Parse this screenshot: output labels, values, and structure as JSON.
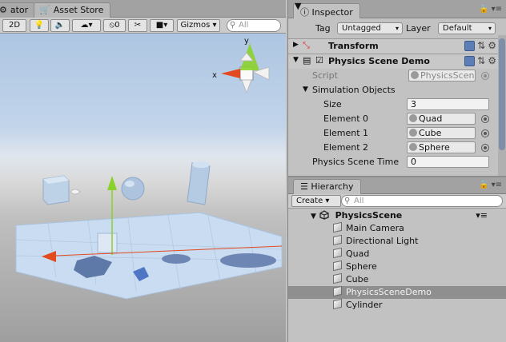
{
  "scene": {
    "tabs": [
      {
        "label": "ator",
        "icon": "gear-icon"
      },
      {
        "label": "Asset Store",
        "icon": "cart-icon"
      }
    ],
    "toolbar": {
      "mode_2d": "2D",
      "fx_count": "0",
      "gizmos_label": "Gizmos",
      "search_placeholder": "All"
    },
    "axis_label_x": "x",
    "axis_label_y": "y"
  },
  "inspector": {
    "tab_label": "Inspector",
    "tag_label": "Tag",
    "tag_value": "Untagged",
    "layer_label": "Layer",
    "layer_value": "Default",
    "transform_title": "Transform",
    "component_title": "Physics Scene Demo",
    "component_enabled": true,
    "script_label": "Script",
    "script_value": "PhysicsScen",
    "sim_objects_label": "Simulation Objects",
    "size_label": "Size",
    "size_value": "3",
    "elements": [
      {
        "label": "Element 0",
        "value": "Quad"
      },
      {
        "label": "Element 1",
        "value": "Cube"
      },
      {
        "label": "Element 2",
        "value": "Sphere"
      }
    ],
    "pst_label": "Physics Scene Time",
    "pst_value": "0"
  },
  "hierarchy": {
    "tab_label": "Hierarchy",
    "create_label": "Create",
    "search_placeholder": "All",
    "scene_name": "PhysicsScene",
    "items": [
      {
        "label": "Main Camera",
        "selected": false
      },
      {
        "label": "Directional Light",
        "selected": false
      },
      {
        "label": "Quad",
        "selected": false
      },
      {
        "label": "Sphere",
        "selected": false
      },
      {
        "label": "Cube",
        "selected": false
      },
      {
        "label": "PhysicsSceneDemo",
        "selected": true
      },
      {
        "label": "Cylinder",
        "selected": false
      }
    ]
  },
  "colors": {
    "selection": "#8f8f8f",
    "axis_x": "#e34a1f",
    "axis_y": "#8bd12b",
    "axis_z": "#3c79d6"
  }
}
